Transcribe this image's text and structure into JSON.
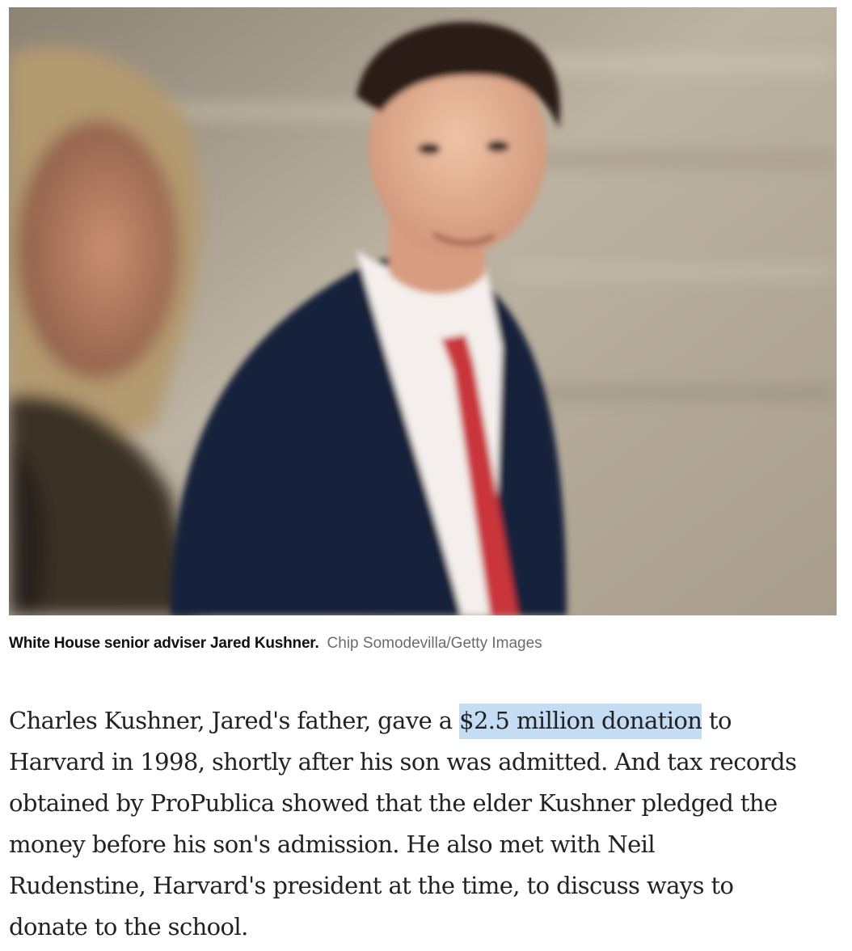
{
  "figure": {
    "caption": "White House senior adviser Jared Kushner.",
    "credit": "Chip Somodevilla/Getty Images"
  },
  "article": {
    "lines": [
      {
        "before": "Charles Kushner, Jared's father, gave a ",
        "highlight": "$2.5 million donation",
        "after": " to"
      },
      {
        "text": "Harvard in 1998, shortly after his son was admitted. And tax records"
      },
      {
        "text": "obtained by ProPublica showed that the elder Kushner pledged the"
      },
      {
        "text": "money before his son's admission. He also met with Neil"
      },
      {
        "text": "Rudenstine, Harvard's president at the time, to discuss ways to"
      },
      {
        "text": "donate to the school."
      }
    ],
    "highlight_color": "#c5dcf5"
  }
}
